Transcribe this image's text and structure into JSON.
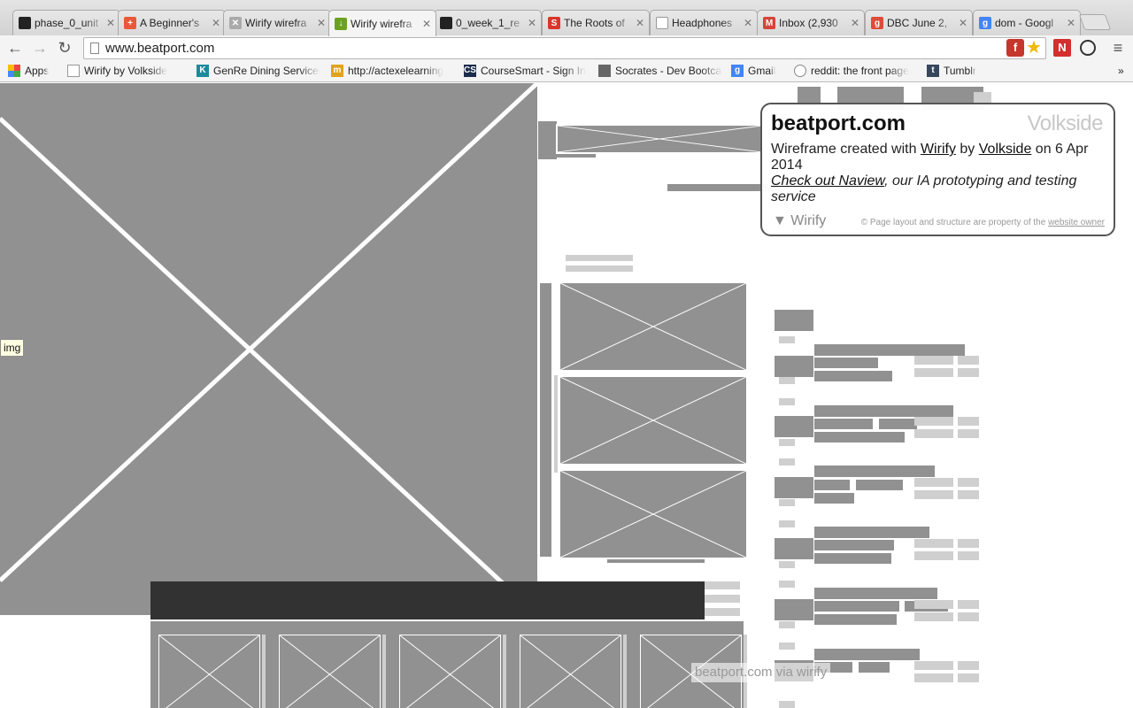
{
  "browser": {
    "tabs": [
      {
        "title": "phase_0_unit",
        "icon": "github-icon",
        "color": "#222222"
      },
      {
        "title": "A Beginner's",
        "icon": "plus-icon",
        "color": "#e8593c"
      },
      {
        "title": "Wirify wirefra",
        "icon": "wireframe-icon",
        "color": "#999999"
      },
      {
        "title": "Wirify wirefra",
        "icon": "download-icon",
        "color": "#6aa121"
      },
      {
        "title": "0_week_1_re",
        "icon": "github-icon",
        "color": "#222222"
      },
      {
        "title": "The Roots of",
        "icon": "roots-icon",
        "color": "#d9362b"
      },
      {
        "title": "Headphones",
        "icon": "page-icon",
        "color": "#ffffff"
      },
      {
        "title": "Inbox (2,930",
        "icon": "gmail-icon",
        "color": "#d44638"
      },
      {
        "title": "DBC June 2,",
        "icon": "google-plus-icon",
        "color": "#dd4b39"
      },
      {
        "title": "dom - Googl",
        "icon": "google-icon",
        "color": "#4285f4"
      }
    ],
    "active_tab": 3,
    "url": "www.beatport.com",
    "bookmarks": [
      {
        "label": "Apps",
        "icon": "apps-icon"
      },
      {
        "label": "Wirify by Volkside",
        "icon": "page-icon"
      },
      {
        "label": "GenRe Dining Services",
        "icon": "k-icon"
      },
      {
        "label": "http://actexelearning",
        "icon": "m-icon"
      },
      {
        "label": "CourseSmart - Sign In",
        "icon": "cs-icon"
      },
      {
        "label": "Socrates - Dev Bootcamp",
        "icon": "socrates-icon"
      },
      {
        "label": "Gmail",
        "icon": "google-icon"
      },
      {
        "label": "reddit: the front page",
        "icon": "reddit-icon"
      },
      {
        "label": "Tumblr",
        "icon": "tumblr-icon"
      }
    ],
    "overflow_label": "»"
  },
  "page": {
    "tooltip": "img",
    "via_label": "beatport.com via wirify",
    "wirify": {
      "site": "beatport.com",
      "brand": "Volkside",
      "created_prefix": "Wireframe created with",
      "wirify_link": "Wirify",
      "by": "by",
      "volkside_link": "Volkside",
      "date": "on 6 Apr 2014",
      "naview_link": "Check out Naview",
      "naview_suffix": ", our IA prototyping and testing service",
      "toggle_label": "▼ Wirify",
      "copyright_prefix": "© Page layout and structure are property of the",
      "owner_link": "website owner"
    }
  },
  "colors": {
    "wire_fill": "#919191",
    "wire_light": "#cfcfcf",
    "dark_bar": "#323232"
  }
}
